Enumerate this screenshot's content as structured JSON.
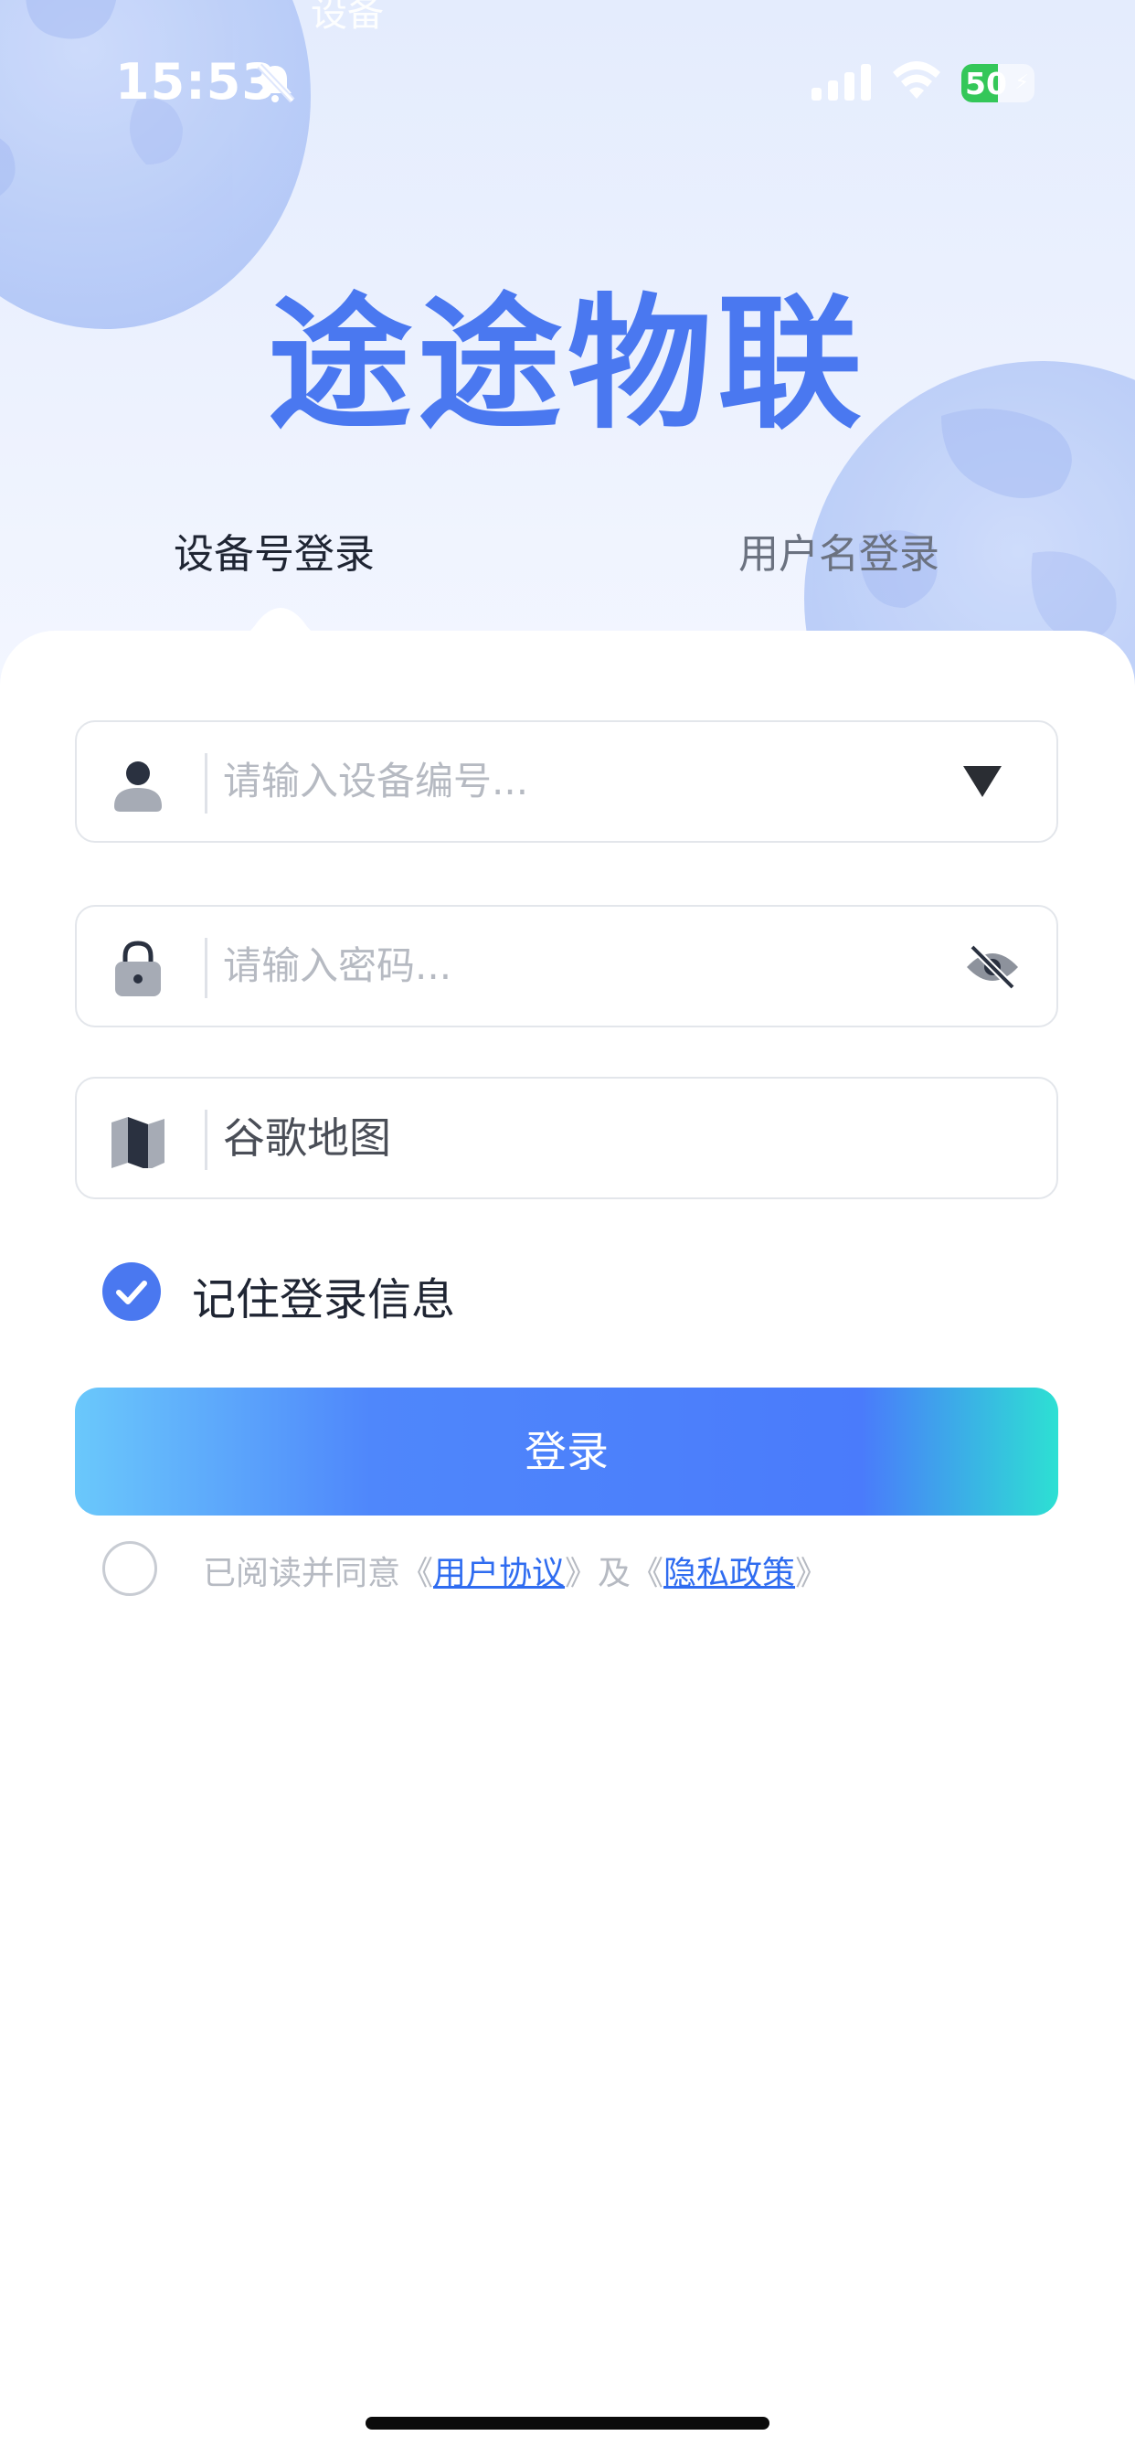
{
  "status_bar": {
    "time": "15:53",
    "battery": "50"
  },
  "header": {
    "ghost_text": "设备",
    "app_title": "途途物联"
  },
  "tabs": [
    {
      "label": "设备号登录",
      "active": true
    },
    {
      "label": "用户名登录",
      "active": false
    }
  ],
  "form": {
    "device_placeholder": "请输入设备编号...",
    "password_placeholder": "请输入密码...",
    "map_value": "谷歌地图"
  },
  "remember": {
    "label": "记住登录信息",
    "checked": true
  },
  "login_button": {
    "label": "登录"
  },
  "agreement": {
    "prefix": "已阅读并同意《",
    "user_agreement": "用户协议",
    "middle": "》及《",
    "privacy_policy": "隐私政策",
    "suffix": "》",
    "checked": false
  },
  "colors": {
    "brand": "#4a78f0",
    "link": "#2f6cf0",
    "battery": "#34c759"
  },
  "icons": [
    "bell-slash-icon",
    "signal-icon",
    "wifi-icon",
    "battery-icon",
    "user-icon",
    "chevron-down-icon",
    "lock-icon",
    "eye-slash-icon",
    "map-icon",
    "check-icon"
  ]
}
